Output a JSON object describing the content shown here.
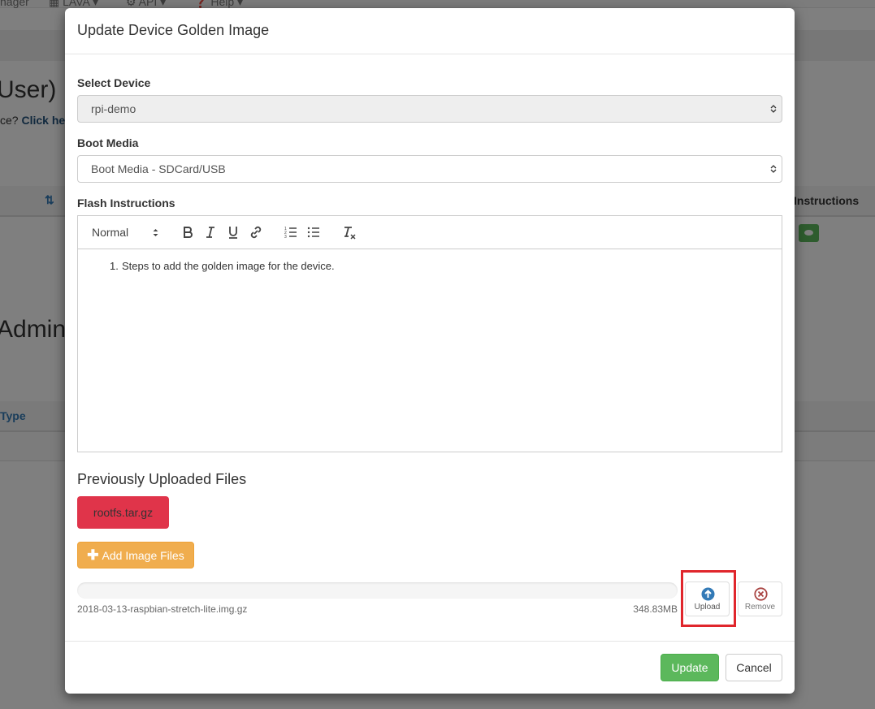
{
  "background": {
    "nav_items": [
      "nager",
      "LAVA",
      "API",
      "Help"
    ],
    "heading_user": "User)",
    "prompt_text": "ce? ",
    "prompt_link": "Click her",
    "col_instructions": "Instructions",
    "heading_admin": "Admin)",
    "col_type": "Type"
  },
  "modal": {
    "title": "Update Device Golden Image",
    "select_device_label": "Select Device",
    "select_device_value": "rpi-demo",
    "boot_media_label": "Boot Media",
    "boot_media_value": "Boot Media - SDCard/USB",
    "flash_label": "Flash Instructions",
    "editor": {
      "format_value": "Normal",
      "content_number": "1.",
      "content_text": "Steps to add the golden image for the device."
    },
    "previous_heading": "Previously Uploaded Files",
    "previous_file": "rootfs.tar.gz",
    "add_files_label": "Add Image Files",
    "pending_file": {
      "name": "2018-03-13-raspbian-stretch-lite.img.gz",
      "size": "348.83MB",
      "progress": 0
    },
    "upload_label": "Upload",
    "remove_label": "Remove",
    "update_label": "Update",
    "cancel_label": "Cancel"
  },
  "colors": {
    "upload_icon": "#337ab7",
    "remove_icon": "#a94442",
    "highlight": "#e0262c",
    "update_button": "#5cb85c",
    "add_button": "#f0ad4e",
    "file_chip": "#e0344a"
  }
}
